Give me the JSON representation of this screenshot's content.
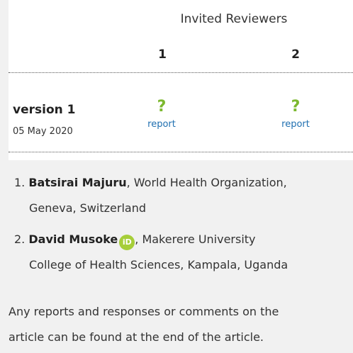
{
  "table": {
    "header": "Invited Reviewers",
    "columns": [
      "1",
      "2"
    ],
    "version": {
      "label": "version 1",
      "date": "05 May 2020",
      "reviews": [
        {
          "status_icon": "question-mark-icon",
          "status_symbol": "?",
          "link": "report"
        },
        {
          "status_icon": "question-mark-icon",
          "status_symbol": "?",
          "link": "report"
        }
      ]
    }
  },
  "reviewers": [
    {
      "number": "1.",
      "name": "Batsirai Majuru",
      "affiliation_line1": ", World Health Organization,",
      "affiliation_line2": "Geneva, Switzerland",
      "orcid": false
    },
    {
      "number": "2.",
      "name": "David Musoke",
      "orcid_label": "iD",
      "affiliation_line1": ", Makerere University",
      "affiliation_line2": "College of Health Sciences, Kampala, Uganda",
      "orcid": true
    }
  ],
  "footer": {
    "line1": "Any reports and responses or comments on the",
    "line2": "article can be found at the end of the article."
  },
  "colors": {
    "accent_green": "#7cb82f",
    "link_blue": "#1f6fb0",
    "orcid_green": "#a6ce39",
    "panel_gray": "#f1f1f1"
  }
}
